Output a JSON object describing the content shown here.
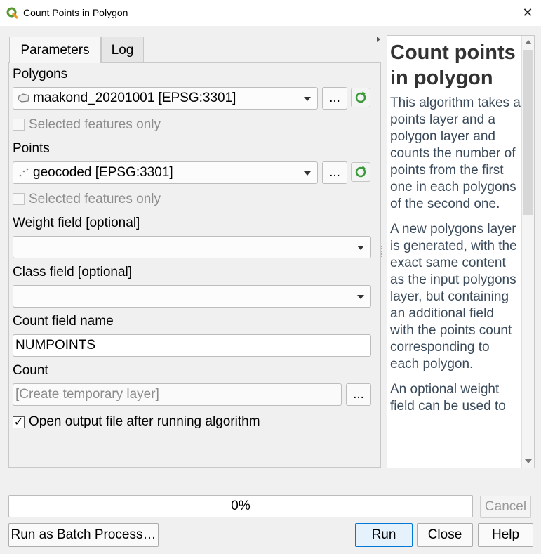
{
  "window": {
    "title": "Count Points in Polygon"
  },
  "tabs": [
    {
      "label": "Parameters"
    },
    {
      "label": "Log"
    }
  ],
  "params": {
    "polygons": {
      "label": "Polygons",
      "value": "maakond_20201001 [EPSG:3301]",
      "selected_only_label": "Selected features only",
      "selected_only_checked": false
    },
    "points": {
      "label": "Points",
      "value": "geocoded [EPSG:3301]",
      "selected_only_label": "Selected features only",
      "selected_only_checked": false
    },
    "weight_field": {
      "label": "Weight field [optional]",
      "value": ""
    },
    "class_field": {
      "label": "Class field [optional]",
      "value": ""
    },
    "count_field_name": {
      "label": "Count field name",
      "value": "NUMPOINTS"
    },
    "count": {
      "label": "Count",
      "placeholder": "[Create temporary layer]"
    },
    "open_output": {
      "label": "Open output file after running algorithm",
      "checked": true
    },
    "browse_label": "..."
  },
  "help": {
    "title": "Count points in polygon",
    "paragraphs": [
      "This algorithm takes a points layer and a polygon layer and counts the number of points from the first one in each polygons of the second one.",
      "A new polygons layer is generated, with the exact same content as the input polygons layer, but containing an additional field with the points count corresponding to each polygon.",
      "An optional weight field can be used to"
    ]
  },
  "progress": {
    "text": "0%",
    "value": 0
  },
  "buttons": {
    "cancel": "Cancel",
    "batch": "Run as Batch Process…",
    "run": "Run",
    "close": "Close",
    "help": "Help"
  },
  "icons": {
    "app": "qgis-icon",
    "close": "close-icon",
    "refresh": "iterate-icon"
  },
  "colors": {
    "qgis_green": "#589632",
    "accent": "#0078d7"
  }
}
